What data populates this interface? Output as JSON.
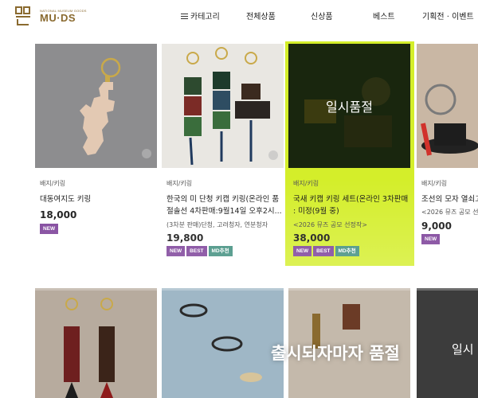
{
  "logo": {
    "small_text": "NATIONAL MUSEUM GOODS",
    "main_text": "MU·DS"
  },
  "nav": {
    "category": "카테고리",
    "all": "전체상품",
    "new": "신상품",
    "best": "베스트",
    "event": "기획전 · 이벤트"
  },
  "products": [
    {
      "category": "배지/키링",
      "title": "대동여지도 키링",
      "subtitle": "",
      "price": "18,000",
      "badges": [
        "NEW"
      ]
    },
    {
      "category": "배지/키링",
      "title": "한국의 미 단청 키캡 키링(온라인 품절솔선 4차판매:9월14일 오후2시...",
      "subtitle": "(3차분 판매)단청, 고려청자, 연분청자",
      "price": "19,800",
      "badges": [
        "NEW",
        "BEST",
        "MD추천"
      ]
    },
    {
      "category": "배지/키링",
      "title": "국새 키캡 키링 세트(온라인 3차판매 : 미정(9월 중)",
      "subtitle": "<2026 뮤즈 공모 선정작>",
      "price": "38,000",
      "badges": [
        "NEW",
        "BEST",
        "MD추천"
      ],
      "overlay": "일시품절"
    },
    {
      "category": "배지/키링",
      "title": "조선의 모자 열쇠고리",
      "subtitle": "<2026 뮤즈 공모 선",
      "price": "9,000",
      "badges": [
        "NEW"
      ]
    }
  ],
  "row2": {
    "soldout_text": "출시되자마자 품절",
    "soldout_short": "일시"
  },
  "colors": {
    "brand": "#8a6a2f",
    "badge_purple": "#7b3f98",
    "badge_teal": "#3d8d7c",
    "highlight": "#d4ee2a"
  }
}
